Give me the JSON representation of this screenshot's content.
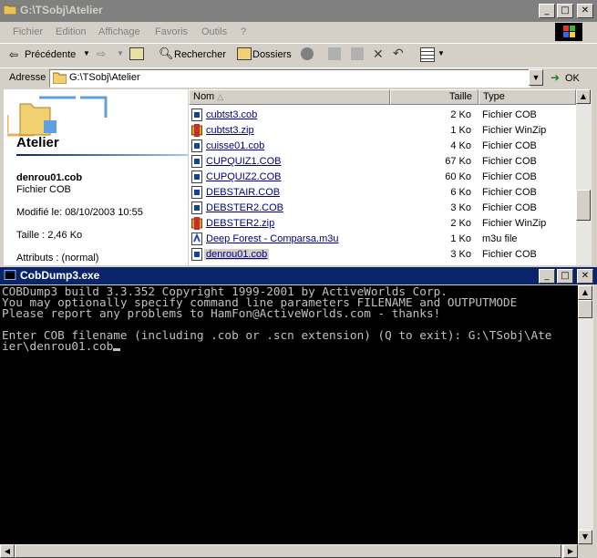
{
  "explorer": {
    "title": "G:\\TSobj\\Atelier",
    "menu": [
      "Fichier",
      "Edition",
      "Affichage",
      "Favoris",
      "Outils",
      "?"
    ],
    "toolbar": {
      "back": "Précédente",
      "search": "Rechercher",
      "folders": "Dossiers"
    },
    "address": {
      "label": "Adresse",
      "value": "G:\\TSobj\\Atelier",
      "go": "OK"
    },
    "left_pane": {
      "folder_title": "Atelier",
      "selected_name": "denrou01.cob",
      "selected_type": "Fichier COB",
      "modified": "Modifié le: 08/10/2003 10:55",
      "size": "Taille : 2,46 Ko",
      "attributes": "Attributs : (normal)"
    },
    "columns": {
      "name": "Nom",
      "size": "Taille",
      "type": "Type"
    },
    "files": [
      {
        "name": "cubtst3.cob",
        "size": "2 Ko",
        "type": "Fichier COB",
        "icon": "cob-file-icon"
      },
      {
        "name": "cubtst3.zip",
        "size": "1 Ko",
        "type": "Fichier WinZip",
        "icon": "winzip-file-icon"
      },
      {
        "name": "cuisse01.cob",
        "size": "4 Ko",
        "type": "Fichier COB",
        "icon": "cob-file-icon"
      },
      {
        "name": "CUPQUIZ1.COB",
        "size": "67 Ko",
        "type": "Fichier COB",
        "icon": "cob-file-icon"
      },
      {
        "name": "CUPQUIZ2.COB",
        "size": "60 Ko",
        "type": "Fichier COB",
        "icon": "cob-file-icon"
      },
      {
        "name": "DEBSTAIR.COB",
        "size": "6 Ko",
        "type": "Fichier COB",
        "icon": "cob-file-icon"
      },
      {
        "name": "DEBSTER2.COB",
        "size": "3 Ko",
        "type": "Fichier COB",
        "icon": "cob-file-icon"
      },
      {
        "name": "DEBSTER2.zip",
        "size": "2 Ko",
        "type": "Fichier WinZip",
        "icon": "winzip-file-icon"
      },
      {
        "name": "Deep Forest - Comparsa.m3u",
        "size": "1 Ko",
        "type": "m3u file",
        "icon": "m3u-file-icon"
      },
      {
        "name": "denrou01.cob",
        "size": "3 Ko",
        "type": "Fichier COB",
        "icon": "cob-file-icon"
      }
    ]
  },
  "console": {
    "title": "CobDump3.exe",
    "lines": [
      "COBDump3 build 3.3.352 Copyright 1999-2001 by ActiveWorlds Corp.",
      "You may optionally specify command line parameters FILENAME and OUTPUTMODE",
      "Please report any problems to HamFon@ActiveWorlds.com - thanks!",
      "",
      "Enter COB filename (including .cob or .scn extension) (Q to exit): G:\\TSobj\\Ate",
      "ier\\denrou01.cob"
    ]
  },
  "colors": {
    "active_title": "#0a246a",
    "inactive_title": "#808080",
    "link": "#000080",
    "console_text": "#c0c0c0"
  }
}
